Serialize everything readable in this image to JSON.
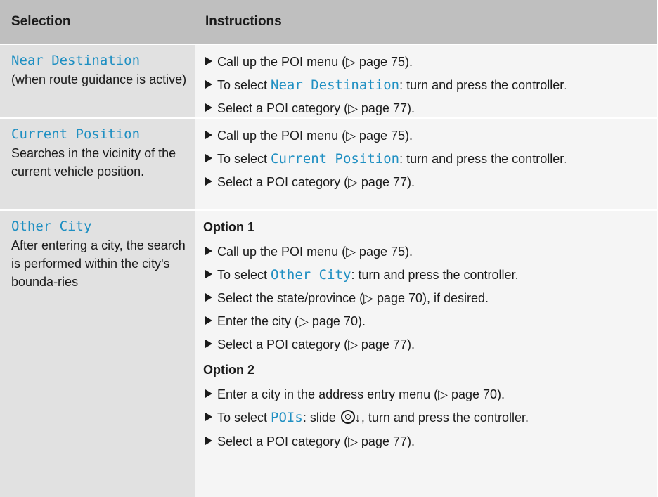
{
  "header": {
    "col1": "Selection",
    "col2": "Instructions"
  },
  "rows": [
    {
      "label": "Near Destination",
      "desc": "(when route guidance is active)",
      "steps": [
        {
          "pre": "Call up the POI menu (▷ page 75)."
        },
        {
          "pre": "To select ",
          "mono": "Near Destination",
          "post": ": turn and press the controller."
        },
        {
          "pre": "Select a POI category (▷ page 77)."
        }
      ]
    },
    {
      "label": "Current Position",
      "desc": "Searches in the vicinity of the current vehicle position.",
      "steps": [
        {
          "pre": "Call up the POI menu (▷ page 75)."
        },
        {
          "pre": "To select ",
          "mono": "Current Position",
          "post": ": turn and press the controller."
        },
        {
          "pre": "Select a POI category (▷ page 77)."
        }
      ]
    },
    {
      "label": "Other City",
      "desc": "After entering a city, the search is performed within the city's bounda-ries",
      "option1": {
        "title": "Option 1",
        "steps": [
          {
            "pre": "Call up the POI menu (▷ page 75)."
          },
          {
            "pre": "To select ",
            "mono": "Other City",
            "post": ": turn and press the controller."
          },
          {
            "pre": "Select the state/province (▷ page 70), if desired."
          },
          {
            "pre": "Enter the city (▷ page 70)."
          },
          {
            "pre": "Select a POI category (▷ page 77)."
          }
        ]
      },
      "option2": {
        "title": "Option 2",
        "steps": [
          {
            "pre": "Enter a city in the address entry menu (▷ page 70)."
          },
          {
            "pre": "To select ",
            "mono": "POIs",
            "post_a": ": slide ",
            "post_b": ", turn and press the controller."
          },
          {
            "pre": "Select a POI category (▷ page 77)."
          }
        ]
      }
    }
  ]
}
